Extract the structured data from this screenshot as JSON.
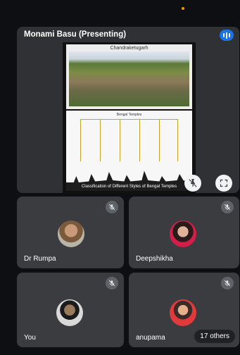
{
  "presenter": {
    "name": "Monami Basu (Presenting)",
    "slide": {
      "photo_title": "Chandraketugarh",
      "diagram_title": "Bengal Temples",
      "diagram_caption": "Classification of Different Styles of Bengal Temples"
    }
  },
  "participants": [
    {
      "name": "Dr Rumpa",
      "muted": true
    },
    {
      "name": "Deepshikha",
      "muted": true
    },
    {
      "name": "You",
      "muted": true
    },
    {
      "name": "anupama",
      "muted": true
    }
  ],
  "others_label": "17 others",
  "icons": {
    "audio": "audio-level-icon",
    "pin": "unpin-icon",
    "fullscreen": "fullscreen-icon",
    "mute": "mic-off-icon"
  },
  "colors": {
    "accent": "#1a73e8",
    "tile": "#3a3c40",
    "background": "#0d0f12"
  }
}
